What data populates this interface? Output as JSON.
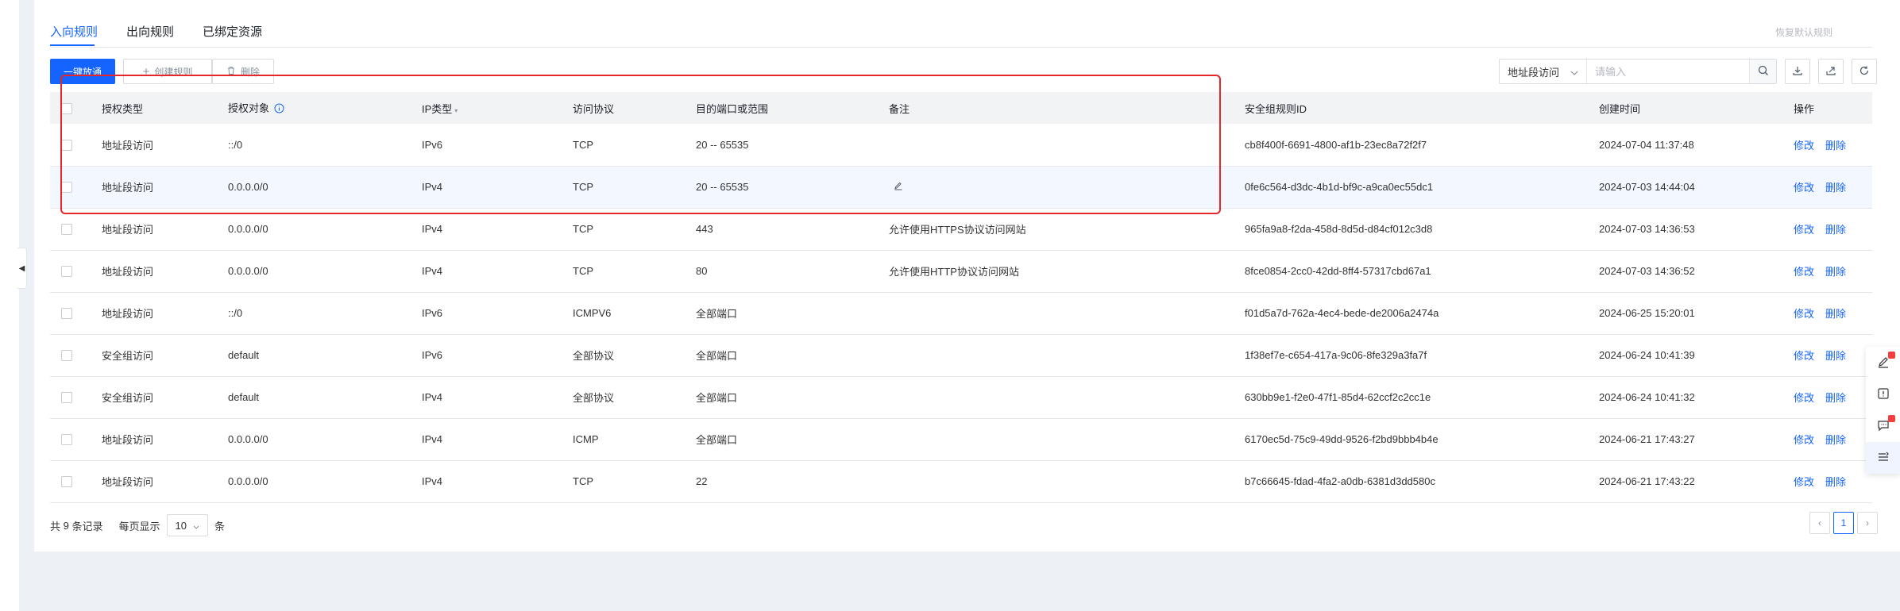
{
  "tabs": [
    {
      "label": "入向规则"
    },
    {
      "label": "出向规则"
    },
    {
      "label": "已绑定资源"
    }
  ],
  "restore_default": "恢复默认规则",
  "toolbar": {
    "quick_allow": "一键放通",
    "create_rule": "创建规则",
    "delete": "删除"
  },
  "filter": {
    "select_value": "地址段访问",
    "placeholder": "请输入"
  },
  "table": {
    "headers": {
      "auth_type": "授权类型",
      "auth_object": "授权对象",
      "ip_type": "IP类型",
      "protocol": "访问协议",
      "port": "目的端口或范围",
      "remark": "备注",
      "rule_id": "安全组规则ID",
      "created": "创建时间",
      "actions": "操作"
    },
    "edit_label": "修改",
    "delete_label": "删除",
    "rows": [
      {
        "auth_type": "地址段访问",
        "auth_object": "::/0",
        "ip_type": "IPv6",
        "protocol": "TCP",
        "port": "20 -- 65535",
        "remark": "",
        "rule_id": "cb8f400f-6691-4800-af1b-23ec8a72f2f7",
        "created": "2024-07-04 11:37:48"
      },
      {
        "auth_type": "地址段访问",
        "auth_object": "0.0.0.0/0",
        "ip_type": "IPv4",
        "protocol": "TCP",
        "port": "20 -- 65535",
        "remark": "",
        "rule_id": "0fe6c564-d3dc-4b1d-bf9c-a9ca0ec55dc1",
        "created": "2024-07-03 14:44:04"
      },
      {
        "auth_type": "地址段访问",
        "auth_object": "0.0.0.0/0",
        "ip_type": "IPv4",
        "protocol": "TCP",
        "port": "443",
        "remark": "允许使用HTTPS协议访问网站",
        "rule_id": "965fa9a8-f2da-458d-8d5d-d84cf012c3d8",
        "created": "2024-07-03 14:36:53"
      },
      {
        "auth_type": "地址段访问",
        "auth_object": "0.0.0.0/0",
        "ip_type": "IPv4",
        "protocol": "TCP",
        "port": "80",
        "remark": "允许使用HTTP协议访问网站",
        "rule_id": "8fce0854-2cc0-42dd-8ff4-57317cbd67a1",
        "created": "2024-07-03 14:36:52"
      },
      {
        "auth_type": "地址段访问",
        "auth_object": "::/0",
        "ip_type": "IPv6",
        "protocol": "ICMPV6",
        "port": "全部端口",
        "remark": "",
        "rule_id": "f01d5a7d-762a-4ec4-bede-de2006a2474a",
        "created": "2024-06-25 15:20:01"
      },
      {
        "auth_type": "安全组访问",
        "auth_object": "default",
        "ip_type": "IPv6",
        "protocol": "全部协议",
        "port": "全部端口",
        "remark": "",
        "rule_id": "1f38ef7e-c654-417a-9c06-8fe329a3fa7f",
        "created": "2024-06-24 10:41:39"
      },
      {
        "auth_type": "安全组访问",
        "auth_object": "default",
        "ip_type": "IPv4",
        "protocol": "全部协议",
        "port": "全部端口",
        "remark": "",
        "rule_id": "630bb9e1-f2e0-47f1-85d4-62ccf2c2cc1e",
        "created": "2024-06-24 10:41:32"
      },
      {
        "auth_type": "地址段访问",
        "auth_object": "0.0.0.0/0",
        "ip_type": "IPv4",
        "protocol": "ICMP",
        "port": "全部端口",
        "remark": "",
        "rule_id": "6170ec5d-75c9-49dd-9526-f2bd9bbb4b4e",
        "created": "2024-06-21 17:43:27"
      },
      {
        "auth_type": "地址段访问",
        "auth_object": "0.0.0.0/0",
        "ip_type": "IPv4",
        "protocol": "TCP",
        "port": "22",
        "remark": "",
        "rule_id": "b7c66645-fdad-4fa2-a0db-6381d3dd580c",
        "created": "2024-06-21 17:43:22"
      }
    ]
  },
  "footer": {
    "total_prefix": "共",
    "total_count": "9",
    "total_suffix": "条记录",
    "per_page_label": "每页显示",
    "per_page_value": "10",
    "per_page_unit": "条",
    "current_page": "1"
  },
  "colors": {
    "accent": "#1664ff",
    "annotation": "#e5262a"
  }
}
